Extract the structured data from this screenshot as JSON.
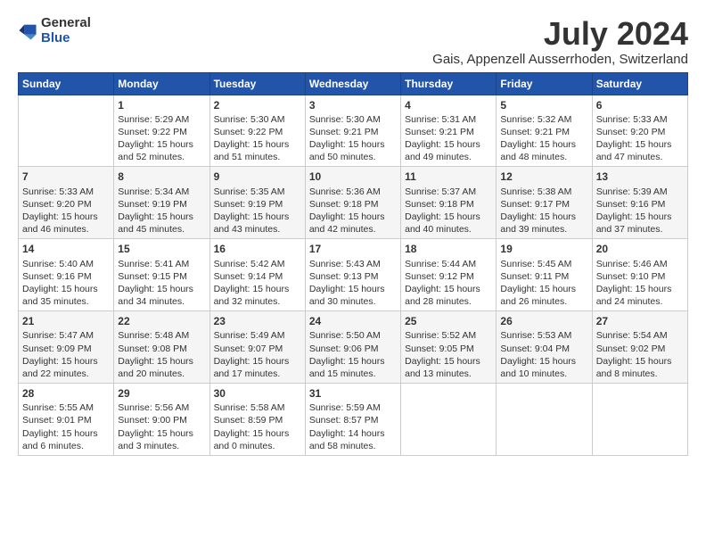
{
  "logo": {
    "general": "General",
    "blue": "Blue"
  },
  "title": "July 2024",
  "subtitle": "Gais, Appenzell Ausserrhoden, Switzerland",
  "headers": [
    "Sunday",
    "Monday",
    "Tuesday",
    "Wednesday",
    "Thursday",
    "Friday",
    "Saturday"
  ],
  "weeks": [
    [
      {
        "day": "",
        "lines": []
      },
      {
        "day": "1",
        "lines": [
          "Sunrise: 5:29 AM",
          "Sunset: 9:22 PM",
          "Daylight: 15 hours",
          "and 52 minutes."
        ]
      },
      {
        "day": "2",
        "lines": [
          "Sunrise: 5:30 AM",
          "Sunset: 9:22 PM",
          "Daylight: 15 hours",
          "and 51 minutes."
        ]
      },
      {
        "day": "3",
        "lines": [
          "Sunrise: 5:30 AM",
          "Sunset: 9:21 PM",
          "Daylight: 15 hours",
          "and 50 minutes."
        ]
      },
      {
        "day": "4",
        "lines": [
          "Sunrise: 5:31 AM",
          "Sunset: 9:21 PM",
          "Daylight: 15 hours",
          "and 49 minutes."
        ]
      },
      {
        "day": "5",
        "lines": [
          "Sunrise: 5:32 AM",
          "Sunset: 9:21 PM",
          "Daylight: 15 hours",
          "and 48 minutes."
        ]
      },
      {
        "day": "6",
        "lines": [
          "Sunrise: 5:33 AM",
          "Sunset: 9:20 PM",
          "Daylight: 15 hours",
          "and 47 minutes."
        ]
      }
    ],
    [
      {
        "day": "7",
        "lines": [
          "Sunrise: 5:33 AM",
          "Sunset: 9:20 PM",
          "Daylight: 15 hours",
          "and 46 minutes."
        ]
      },
      {
        "day": "8",
        "lines": [
          "Sunrise: 5:34 AM",
          "Sunset: 9:19 PM",
          "Daylight: 15 hours",
          "and 45 minutes."
        ]
      },
      {
        "day": "9",
        "lines": [
          "Sunrise: 5:35 AM",
          "Sunset: 9:19 PM",
          "Daylight: 15 hours",
          "and 43 minutes."
        ]
      },
      {
        "day": "10",
        "lines": [
          "Sunrise: 5:36 AM",
          "Sunset: 9:18 PM",
          "Daylight: 15 hours",
          "and 42 minutes."
        ]
      },
      {
        "day": "11",
        "lines": [
          "Sunrise: 5:37 AM",
          "Sunset: 9:18 PM",
          "Daylight: 15 hours",
          "and 40 minutes."
        ]
      },
      {
        "day": "12",
        "lines": [
          "Sunrise: 5:38 AM",
          "Sunset: 9:17 PM",
          "Daylight: 15 hours",
          "and 39 minutes."
        ]
      },
      {
        "day": "13",
        "lines": [
          "Sunrise: 5:39 AM",
          "Sunset: 9:16 PM",
          "Daylight: 15 hours",
          "and 37 minutes."
        ]
      }
    ],
    [
      {
        "day": "14",
        "lines": [
          "Sunrise: 5:40 AM",
          "Sunset: 9:16 PM",
          "Daylight: 15 hours",
          "and 35 minutes."
        ]
      },
      {
        "day": "15",
        "lines": [
          "Sunrise: 5:41 AM",
          "Sunset: 9:15 PM",
          "Daylight: 15 hours",
          "and 34 minutes."
        ]
      },
      {
        "day": "16",
        "lines": [
          "Sunrise: 5:42 AM",
          "Sunset: 9:14 PM",
          "Daylight: 15 hours",
          "and 32 minutes."
        ]
      },
      {
        "day": "17",
        "lines": [
          "Sunrise: 5:43 AM",
          "Sunset: 9:13 PM",
          "Daylight: 15 hours",
          "and 30 minutes."
        ]
      },
      {
        "day": "18",
        "lines": [
          "Sunrise: 5:44 AM",
          "Sunset: 9:12 PM",
          "Daylight: 15 hours",
          "and 28 minutes."
        ]
      },
      {
        "day": "19",
        "lines": [
          "Sunrise: 5:45 AM",
          "Sunset: 9:11 PM",
          "Daylight: 15 hours",
          "and 26 minutes."
        ]
      },
      {
        "day": "20",
        "lines": [
          "Sunrise: 5:46 AM",
          "Sunset: 9:10 PM",
          "Daylight: 15 hours",
          "and 24 minutes."
        ]
      }
    ],
    [
      {
        "day": "21",
        "lines": [
          "Sunrise: 5:47 AM",
          "Sunset: 9:09 PM",
          "Daylight: 15 hours",
          "and 22 minutes."
        ]
      },
      {
        "day": "22",
        "lines": [
          "Sunrise: 5:48 AM",
          "Sunset: 9:08 PM",
          "Daylight: 15 hours",
          "and 20 minutes."
        ]
      },
      {
        "day": "23",
        "lines": [
          "Sunrise: 5:49 AM",
          "Sunset: 9:07 PM",
          "Daylight: 15 hours",
          "and 17 minutes."
        ]
      },
      {
        "day": "24",
        "lines": [
          "Sunrise: 5:50 AM",
          "Sunset: 9:06 PM",
          "Daylight: 15 hours",
          "and 15 minutes."
        ]
      },
      {
        "day": "25",
        "lines": [
          "Sunrise: 5:52 AM",
          "Sunset: 9:05 PM",
          "Daylight: 15 hours",
          "and 13 minutes."
        ]
      },
      {
        "day": "26",
        "lines": [
          "Sunrise: 5:53 AM",
          "Sunset: 9:04 PM",
          "Daylight: 15 hours",
          "and 10 minutes."
        ]
      },
      {
        "day": "27",
        "lines": [
          "Sunrise: 5:54 AM",
          "Sunset: 9:02 PM",
          "Daylight: 15 hours",
          "and 8 minutes."
        ]
      }
    ],
    [
      {
        "day": "28",
        "lines": [
          "Sunrise: 5:55 AM",
          "Sunset: 9:01 PM",
          "Daylight: 15 hours",
          "and 6 minutes."
        ]
      },
      {
        "day": "29",
        "lines": [
          "Sunrise: 5:56 AM",
          "Sunset: 9:00 PM",
          "Daylight: 15 hours",
          "and 3 minutes."
        ]
      },
      {
        "day": "30",
        "lines": [
          "Sunrise: 5:58 AM",
          "Sunset: 8:59 PM",
          "Daylight: 15 hours",
          "and 0 minutes."
        ]
      },
      {
        "day": "31",
        "lines": [
          "Sunrise: 5:59 AM",
          "Sunset: 8:57 PM",
          "Daylight: 14 hours",
          "and 58 minutes."
        ]
      },
      {
        "day": "",
        "lines": []
      },
      {
        "day": "",
        "lines": []
      },
      {
        "day": "",
        "lines": []
      }
    ]
  ]
}
